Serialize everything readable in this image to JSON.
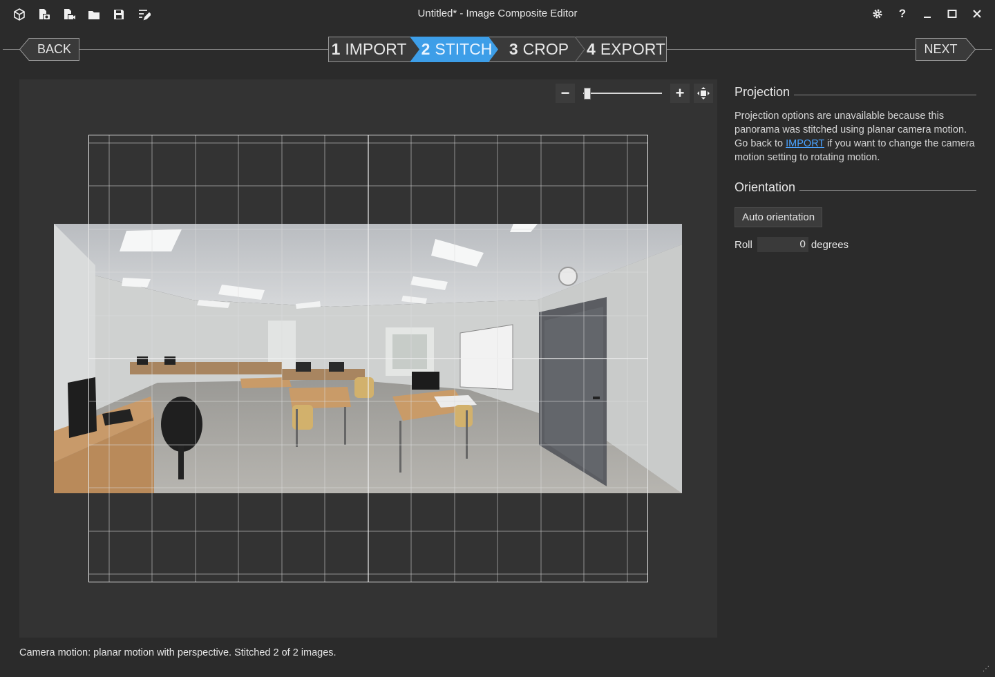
{
  "window": {
    "title": "Untitled* - Image Composite Editor",
    "toolbar_icons": [
      "new-panorama-icon",
      "new-from-images-icon",
      "new-from-video-icon",
      "open-icon",
      "save-icon",
      "rename-icon"
    ],
    "controls": [
      "settings-icon",
      "help-icon",
      "minimize-icon",
      "maximize-icon",
      "close-icon"
    ]
  },
  "nav": {
    "back_label": "BACK",
    "next_label": "NEXT",
    "steps": [
      {
        "num": "1",
        "label": "IMPORT",
        "active": false
      },
      {
        "num": "2",
        "label": "STITCH",
        "active": true
      },
      {
        "num": "3",
        "label": "CROP",
        "active": false
      },
      {
        "num": "4",
        "label": "EXPORT",
        "active": false
      }
    ],
    "active_color": "#3d9ee8"
  },
  "zoom": {
    "minus_label": "−",
    "plus_label": "+",
    "level": 0.05
  },
  "projection": {
    "title": "Projection",
    "text_before_link": "Projection options are unavailable because this panorama was stitched using planar camera motion. Go back to ",
    "link_text": "IMPORT",
    "text_after_link": " if you want to change the camera motion setting to rotating motion."
  },
  "orientation": {
    "title": "Orientation",
    "auto_button": "Auto orientation",
    "roll_label": "Roll",
    "roll_value": "0",
    "roll_unit": "degrees"
  },
  "status": {
    "text": "Camera motion: planar motion with perspective. Stitched 2 of 2 images."
  }
}
